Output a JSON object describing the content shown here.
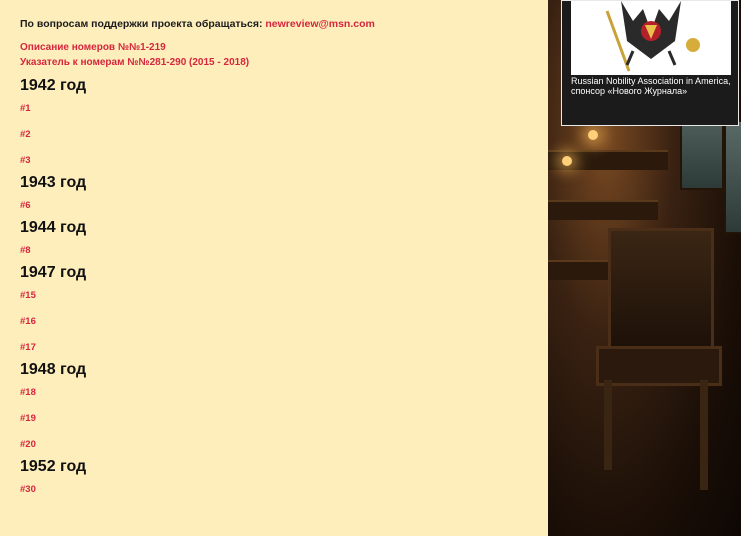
{
  "support": {
    "text": "По вопросам поддержки проекта обращаться: ",
    "email": "newreview@msn.com"
  },
  "links": {
    "description": "Описание номеров №№1-219",
    "index": "Указатель к номерам №№281-290 (2015 - 2018)"
  },
  "years": [
    {
      "year": "1942 год",
      "issues": [
        "#1",
        "#2",
        "#3"
      ]
    },
    {
      "year": "1943 год",
      "issues": [
        "#6"
      ]
    },
    {
      "year": "1944 год",
      "issues": [
        "#8"
      ]
    },
    {
      "year": "1947 год",
      "issues": [
        "#15",
        "#16",
        "#17"
      ]
    },
    {
      "year": "1948 год",
      "issues": [
        "#18",
        "#19",
        "#20"
      ]
    },
    {
      "year": "1952 год",
      "issues": [
        "#30"
      ]
    }
  ],
  "sponsor": {
    "caption": "Russian Nobility Association in America, спонсор «Нового Журнала»"
  },
  "colors": {
    "link": "#d6263d",
    "panel": "#fdeebb"
  }
}
